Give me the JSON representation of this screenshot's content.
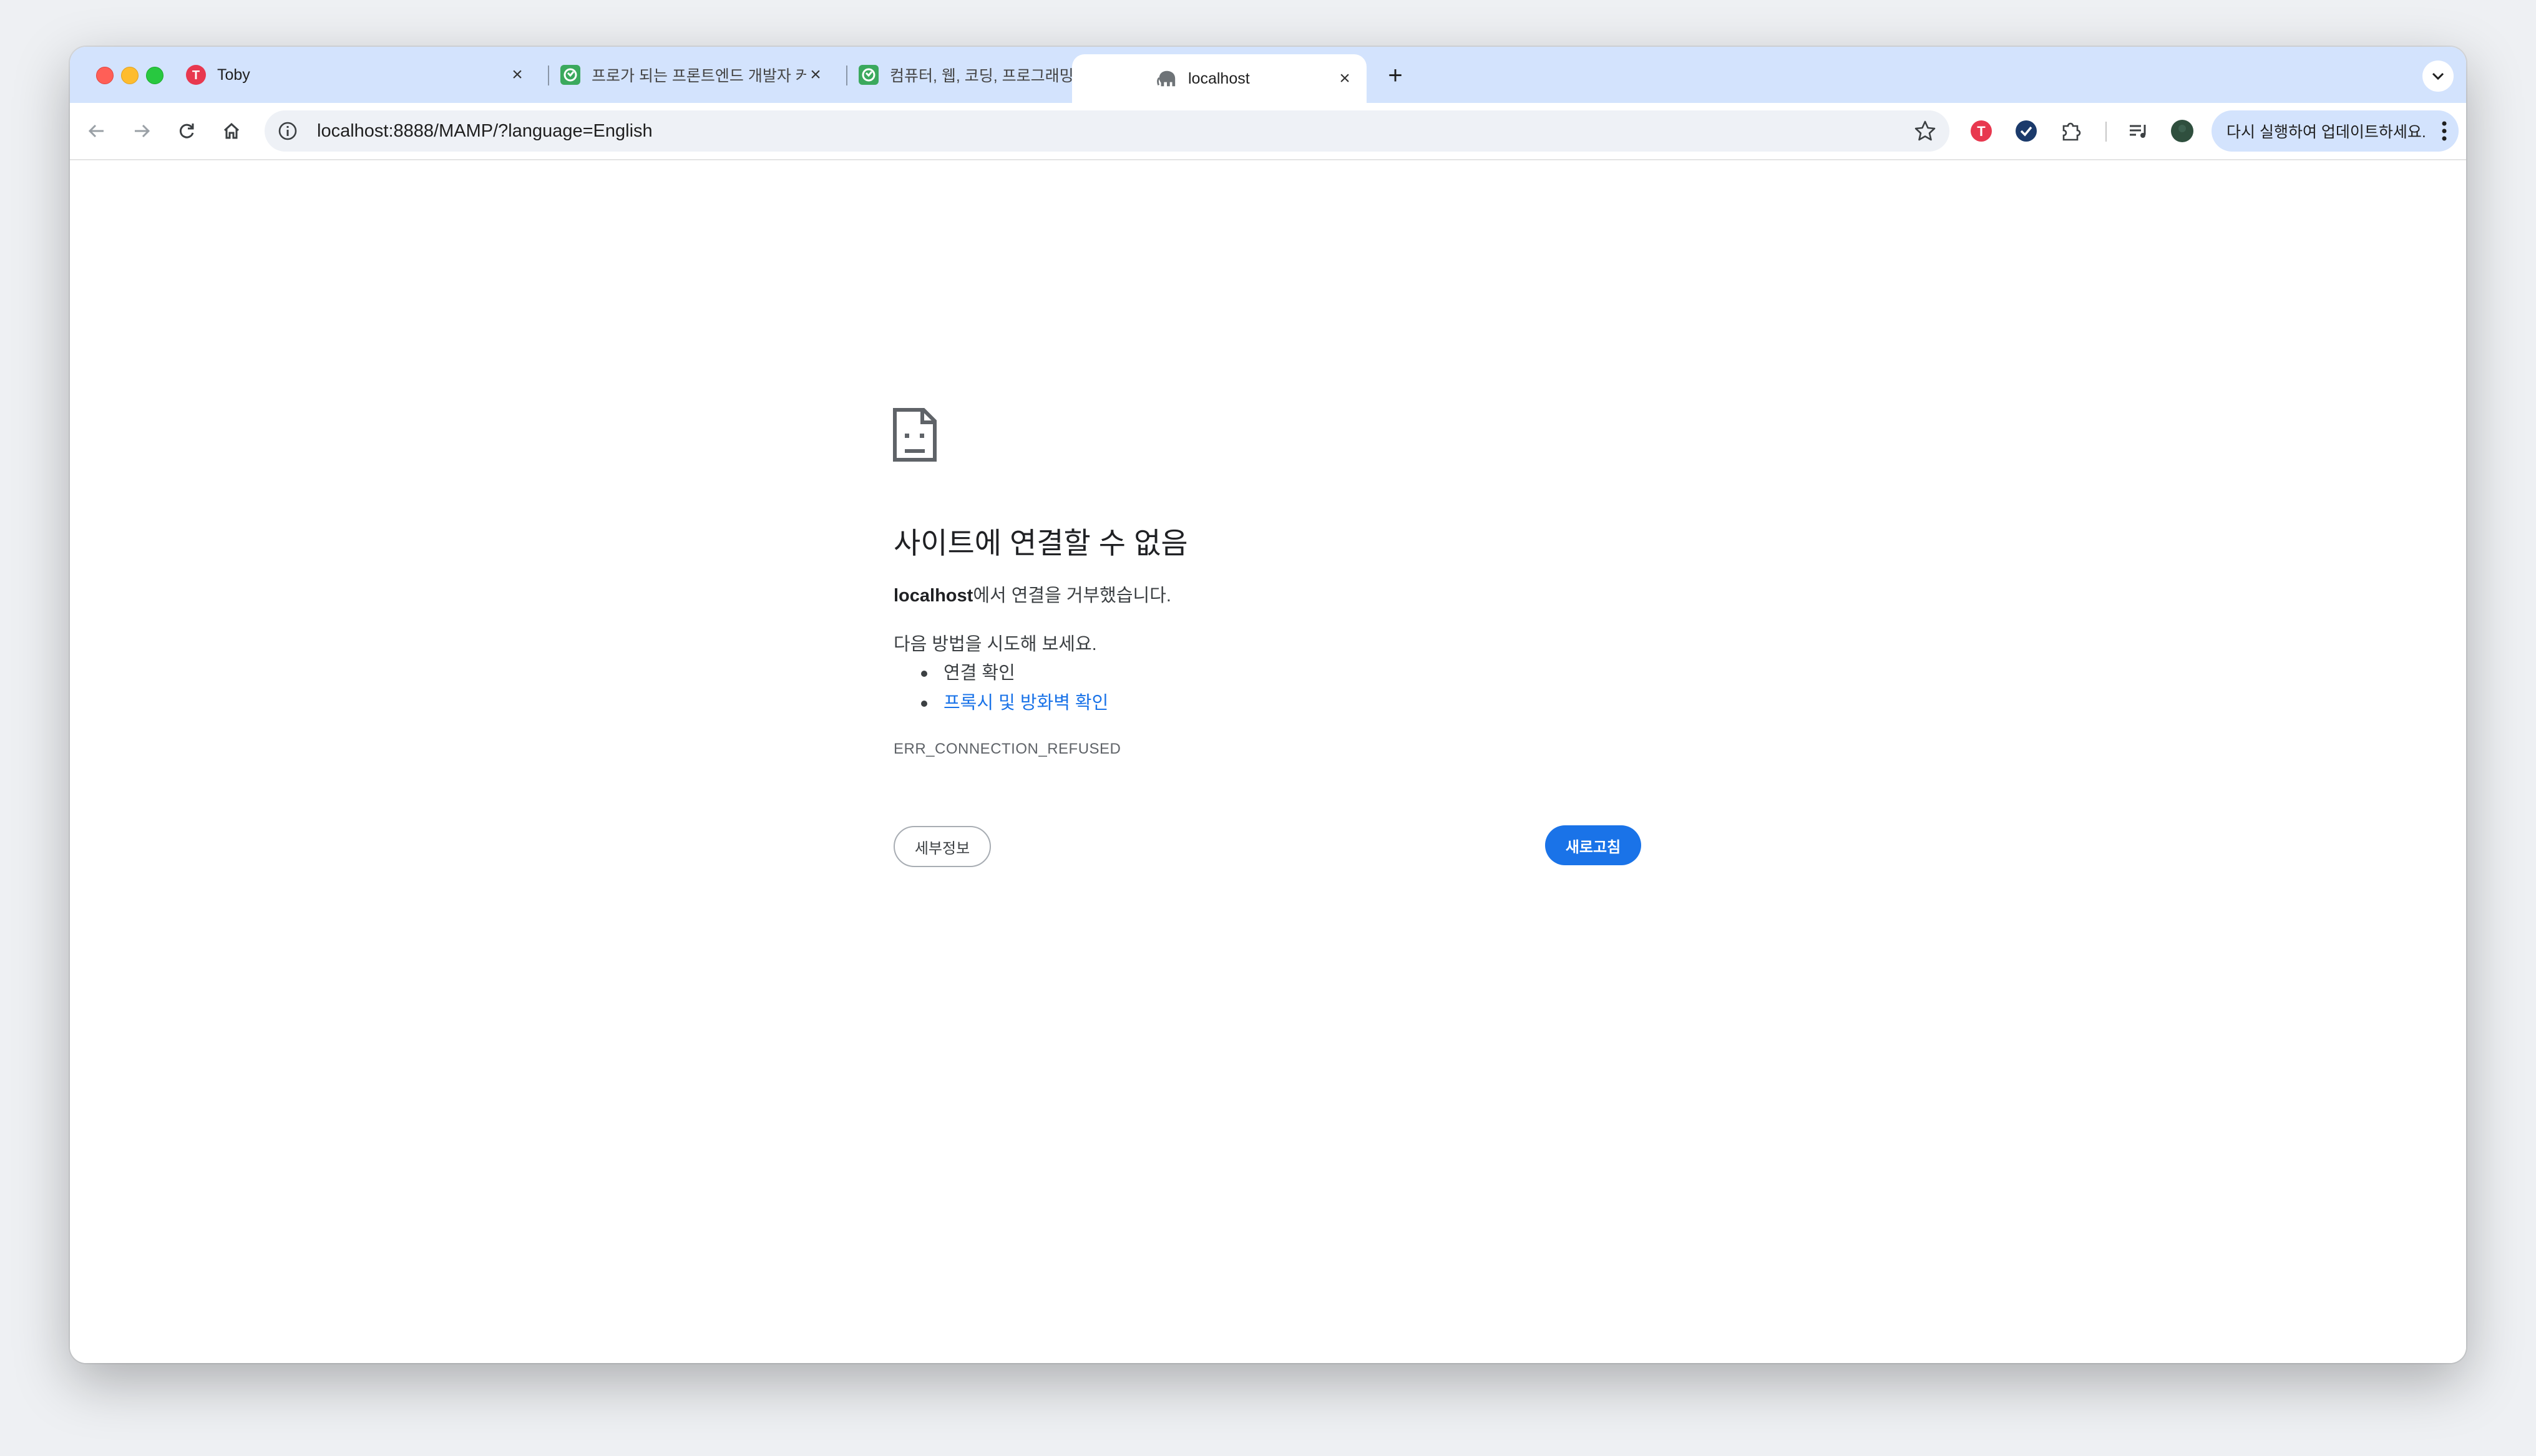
{
  "tabs": [
    {
      "title": "Toby",
      "favicon": "toby-favicon",
      "active": false
    },
    {
      "title": "프로가 되는 프론트엔드 개발자 커리",
      "favicon": "inflearn-favicon",
      "active": false
    },
    {
      "title": "컴퓨터, 웹, 코딩, 프로그래밍의 시작",
      "favicon": "inflearn-favicon",
      "active": false
    },
    {
      "title": "localhost",
      "favicon": "elephant-favicon",
      "active": true
    }
  ],
  "toolbar": {
    "url": "localhost:8888/MAMP/?language=English",
    "update_label": "다시 실행하여 업데이트하세요."
  },
  "error": {
    "title": "사이트에 연결할 수 없음",
    "host": "localhost",
    "message": "에서 연결을 거부했습니다.",
    "try_label": "다음 방법을 시도해 보세요.",
    "suggestions": [
      "연결 확인",
      "프록시 및 방화벽 확인"
    ],
    "code": "ERR_CONNECTION_REFUSED",
    "details_label": "세부정보",
    "reload_label": "새로고침"
  },
  "colors": {
    "accent": "#1a73e8",
    "tabstrip": "#d3e3fd",
    "toby_red": "#e8384f",
    "inflearn_green": "#3ba95d"
  }
}
